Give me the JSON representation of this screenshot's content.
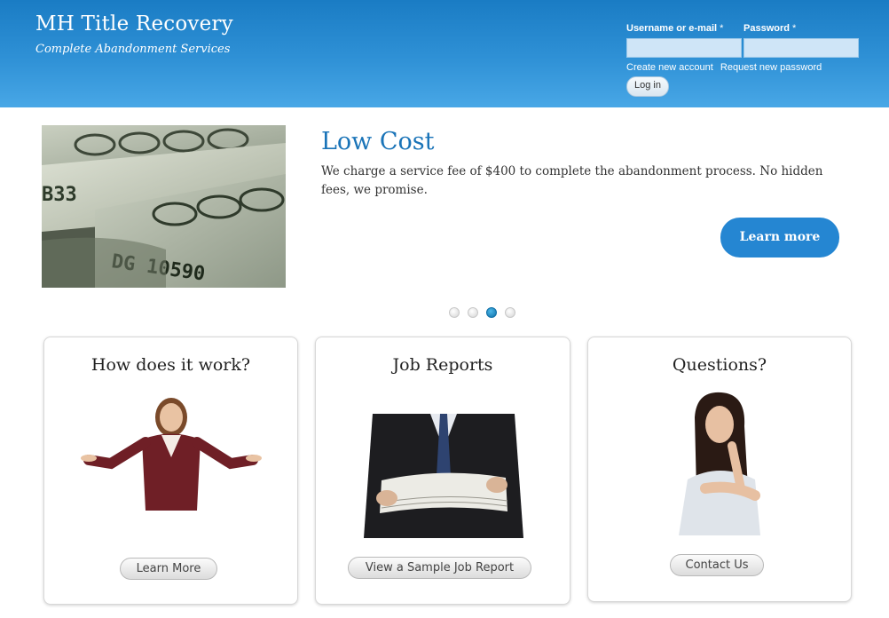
{
  "header": {
    "site_name": "MH Title Recovery",
    "slogan": "Complete Abandonment Services"
  },
  "login": {
    "username_label": "Username or e-mail",
    "password_label": "Password",
    "required_mark": "*",
    "username_value": "",
    "password_value": "",
    "create_account": "Create new account",
    "request_password": "Request new password",
    "submit": "Log in"
  },
  "slider": {
    "title": "Low Cost",
    "body": "We charge a service fee of $400 to complete the abandonment process. No hidden fees, we promise.",
    "button": "Learn more",
    "total_slides": 4,
    "active_slide": 3,
    "image_text": "DG 10590"
  },
  "cards": [
    {
      "title": "How does it work?",
      "button": "Learn More"
    },
    {
      "title": "Job Reports",
      "button": "View a Sample Job Report"
    },
    {
      "title": "Questions?",
      "button": "Contact Us"
    }
  ],
  "colors": {
    "header_gradient_top": "#1a7cc4",
    "header_gradient_bottom": "#48a7e6",
    "accent_blue": "#2586d2",
    "title_blue": "#1a74b8"
  }
}
